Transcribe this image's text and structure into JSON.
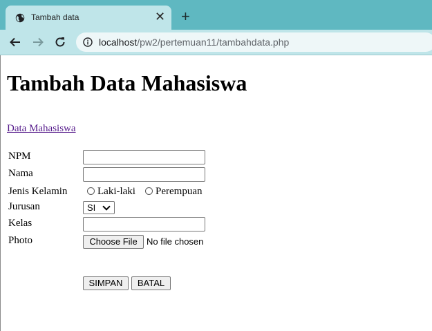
{
  "browser": {
    "tab_title": "Tambah data",
    "tab_close": "✕",
    "new_tab": "+",
    "url_host": "localhost",
    "url_path": "/pw2/pertemuan11/tambahdata.php"
  },
  "page": {
    "heading": "Tambah Data Mahasiswa",
    "back_link": "Data Mahasiswa",
    "form": {
      "labels": {
        "npm": "NPM",
        "nama": "Nama",
        "jenis_kelamin": "Jenis Kelamin",
        "jurusan": "Jurusan",
        "kelas": "Kelas",
        "photo": "Photo"
      },
      "radio_options": [
        "Laki-laki",
        "Perempuan"
      ],
      "jurusan_selected": "SI",
      "file_button": "Choose File",
      "file_status": "No file chosen",
      "submit": "SIMPAN",
      "reset": "BATAL"
    }
  }
}
